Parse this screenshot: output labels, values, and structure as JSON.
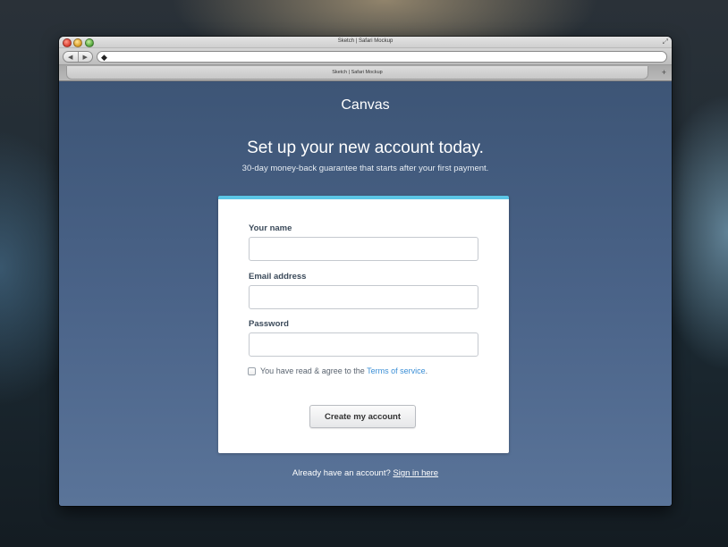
{
  "window": {
    "title": "Sketch | Safari Mockup",
    "tab_label": "Sketch | Safari Mockup"
  },
  "browser": {
    "url_value": "",
    "back_glyph": "◀",
    "forward_glyph": "▶",
    "site_icon_glyph": "◆",
    "resize_glyph": "⤢",
    "new_tab_glyph": "+"
  },
  "page": {
    "brand": "Canvas",
    "headline": "Set up your new account today.",
    "subline": "30-day money-back guarantee that starts after your first payment."
  },
  "form": {
    "name_label": "Your name",
    "name_value": "",
    "email_label": "Email address",
    "email_value": "",
    "password_label": "Password",
    "password_value": "",
    "agree_text": "You have read & agree to the ",
    "terms_link": "Terms of service",
    "agree_suffix": ".",
    "agree_checked": false,
    "submit_label": "Create my account"
  },
  "footer": {
    "prompt": "Already have an account? ",
    "signin_link": "Sign in here"
  },
  "colors": {
    "accent_bar": "#5bc6e6",
    "link": "#3b8fd6",
    "page_background": "#4a6388"
  }
}
